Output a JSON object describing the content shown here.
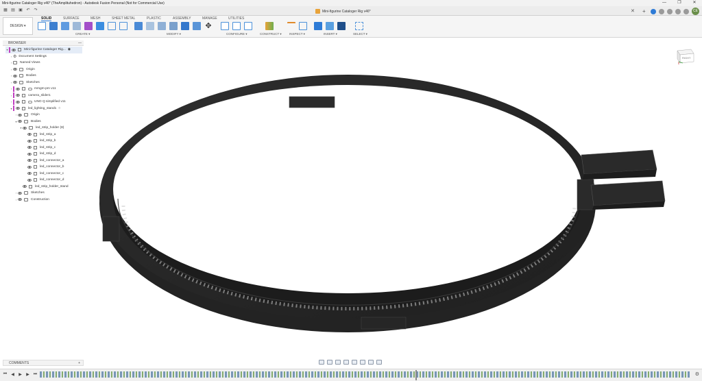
{
  "window": {
    "title": "Mini-figurine Cataloger Rig v46* (TheAmplituhedron) - Autodesk Fusion Personal (Not for Commercial Use)",
    "controls": [
      "—",
      "❐",
      "✕"
    ]
  },
  "document_tab": {
    "label": "Mini-figurine Cataloger Rig v46*",
    "close": "✕"
  },
  "user": {
    "initials": "CE"
  },
  "workspace": {
    "label": "DESIGN ▾"
  },
  "ribbon": {
    "tabs": [
      "SOLID",
      "SURFACE",
      "MESH",
      "SHEET METAL",
      "PLASTIC",
      "UTILITIES",
      "MANAGE",
      "ASSEMBLY"
    ],
    "active_tab": "SOLID",
    "groups": [
      "CREATE ▾",
      "MODIFY ▾",
      "CONFIGURE ▾",
      "CONSTRUCT ▾",
      "INSPECT ▾",
      "INSERT ▾",
      "SELECT ▾"
    ]
  },
  "browser": {
    "header": "BROWSER",
    "items": [
      {
        "label": "Mini-figurine Cataloger Rig..."
      },
      {
        "label": "Document Settings"
      },
      {
        "label": "Named Views"
      },
      {
        "label": "Origin"
      },
      {
        "label": "Bodies"
      },
      {
        "label": "Sketches"
      },
      {
        "label": "mmgm-pm v11"
      },
      {
        "label": "camera_slider1"
      },
      {
        "label": "UNO Q simplified v11"
      },
      {
        "label": "led_lighting_stand1"
      },
      {
        "label": "Origin"
      },
      {
        "label": "Bodies"
      },
      {
        "label": "led_strip_holder (8)"
      },
      {
        "label": "led_strip_a"
      },
      {
        "label": "led_strip_b"
      },
      {
        "label": "led_strip_c"
      },
      {
        "label": "led_strip_d"
      },
      {
        "label": "led_connector_a"
      },
      {
        "label": "led_connector_b"
      },
      {
        "label": "led_connector_c"
      },
      {
        "label": "led_connector_d"
      },
      {
        "label": "led_strip_holder_stand"
      },
      {
        "label": "Sketches"
      },
      {
        "label": "Construction"
      }
    ]
  },
  "viewcube": {
    "face": "RIGHT"
  },
  "comments": {
    "label": "COMMENTS",
    "add": "+"
  },
  "colors": {
    "accent": "#2e7bd6",
    "model": "#2a2a2a",
    "brand_icon": "#e8a33a"
  }
}
